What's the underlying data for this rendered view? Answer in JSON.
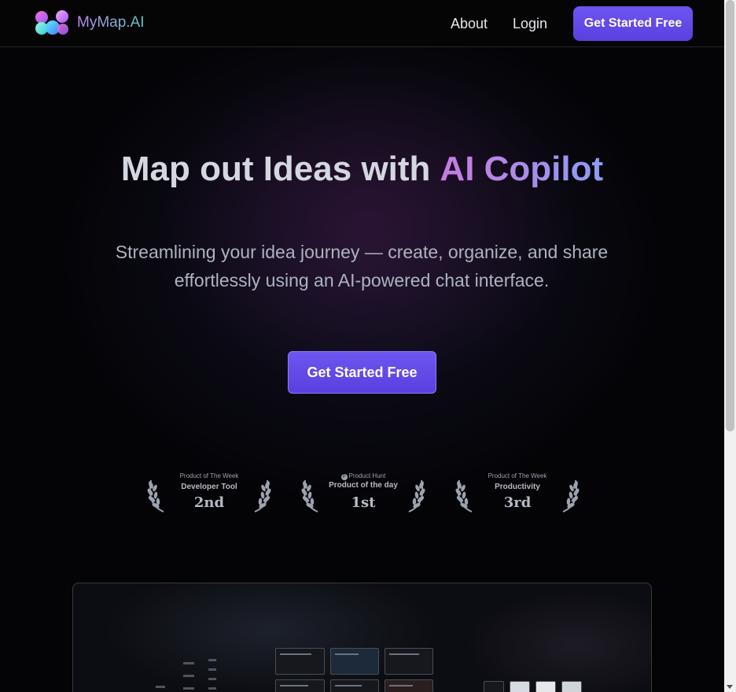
{
  "header": {
    "brand": "MyMap.AI",
    "nav": {
      "about": "About",
      "login": "Login"
    },
    "cta_label": "Get Started Free"
  },
  "hero": {
    "title_main": "Map out Ideas with",
    "title_accent": "AI Copilot",
    "subtitle": "Streamlining your idea journey — create, organize, and share effortlessly using an AI-powered chat interface.",
    "cta_label": "Get Started Free"
  },
  "badges": [
    {
      "top": "Product of The Week",
      "category": "Developer Tool",
      "rank": "2nd"
    },
    {
      "top": "Product Hunt",
      "category": "Product of the day",
      "rank": "1st"
    },
    {
      "top": "Product of The Week",
      "category": "Productivity",
      "rank": "3rd"
    }
  ],
  "colors": {
    "primary_button": "#5b4ae8",
    "accent_gradient_start": "#c77be0",
    "accent_gradient_end": "#8d9cf3",
    "background": "#040407"
  },
  "icons": {
    "logo": "mymap-logo-icon",
    "laurel": "laurel-wreath-icon",
    "product_hunt": "product-hunt-icon"
  }
}
